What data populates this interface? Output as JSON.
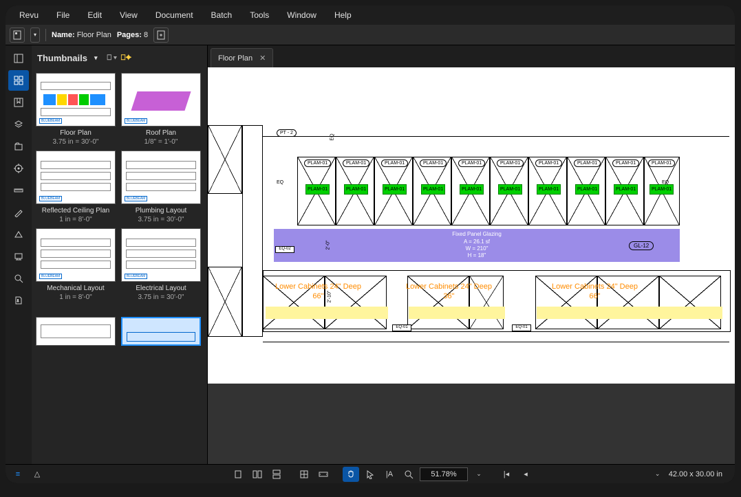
{
  "menu": [
    "Revu",
    "File",
    "Edit",
    "View",
    "Document",
    "Batch",
    "Tools",
    "Window",
    "Help"
  ],
  "propbar": {
    "name_label": "Name:",
    "name_value": "Floor Plan",
    "pages_label": "Pages:",
    "pages_value": "8"
  },
  "thumb_panel": {
    "title": "Thumbnails",
    "items": [
      {
        "label": "Floor Plan",
        "scale": "3.75 in = 30'-0\"",
        "sel": false,
        "art": "colored"
      },
      {
        "label": "Roof Plan",
        "scale": "1/8\" = 1'-0\"",
        "sel": false,
        "art": "purple"
      },
      {
        "label": "Reflected Ceiling Plan",
        "scale": "1 in = 8'-0\"",
        "sel": false,
        "art": "grid"
      },
      {
        "label": "Plumbing Layout",
        "scale": "3.75 in = 30'-0\"",
        "sel": false,
        "art": "grid"
      },
      {
        "label": "Mechanical Layout",
        "scale": "1 in = 8'-0\"",
        "sel": false,
        "art": "grid"
      },
      {
        "label": "Electrical Layout",
        "scale": "3.75 in = 30'-0\"",
        "sel": false,
        "art": "grid"
      },
      {
        "label": "",
        "scale": "",
        "sel": false,
        "art": "misc"
      },
      {
        "label": "",
        "scale": "",
        "sel": true,
        "art": "blue"
      }
    ]
  },
  "tab": {
    "label": "Floor Plan"
  },
  "drawing": {
    "pt_label": "PT - 2",
    "eq": "EQ",
    "plam_bubble": "PLAM-01",
    "plam_green": "PLAM-01",
    "glazing": {
      "title": "Fixed Panel Glazing",
      "a": "A = 26.1 sf",
      "w": "W = 210\"",
      "h": "H = 18\""
    },
    "gl_tag": "GL-12",
    "eq02": "EQ-02",
    "eq01": "EQ-01",
    "dim_210": "2'-10\"",
    "dim_20": "2'-0\"",
    "cab1": {
      "l1": "Lower Cabinets 24\" Deep",
      "l2": "66\""
    },
    "cab2": {
      "l1": "Lower Cabinets 24\" Deep",
      "l2": "36\""
    },
    "cab3": {
      "l1": "Lower Cabinets 24\" Deep",
      "l2": "66\""
    }
  },
  "status": {
    "zoom": "51.78%",
    "dims": "42.00 x 30.00 in"
  }
}
